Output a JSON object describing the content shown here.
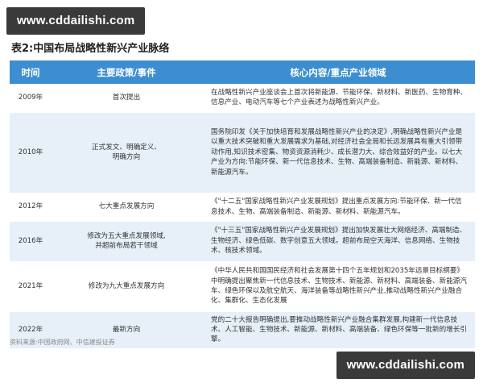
{
  "watermark_text": "www.cddailishi.com",
  "title": "表2:中国布局战略性新兴产业脉络",
  "headers": [
    "时间",
    "主要政策/事件",
    "核心内容/重点产业领域"
  ],
  "rows": [
    {
      "year": "2009年",
      "policy": [
        "首次提出"
      ],
      "content": "在战略性新兴产业座谈会上首次将新能源、节能环保、新材料、新医药、生物育种、信息产业、电动汽车等七个产业表述为战略性新兴产业。"
    },
    {
      "year": "2010年",
      "policy": [
        "正式发文、明确定义、",
        "明确方向"
      ],
      "content": "国务院印发《关于加快培育和发展战略性新兴产业的决定》,明确战略性新兴产业是以重大技术突破和重大发展需求为基础,对经济社会全局和长远发展具有重大引领带动作用,知识技术密集、物资资源消耗少、成长潜力大、综合效益好的产业。以七大产业为方向:节能环保、新一代信息技术、生物、高端装备制造、新能源、新材料、新能源汽车。"
    },
    {
      "year": "2012年",
      "policy": [
        "七大重点发展方向"
      ],
      "content": "《\"十二五\"国家战略性新兴产业发展规划》提出重点发展方向:节能环保、新一代信息技术、生物、高端装备制造、新能源、新材料、新能源汽车。"
    },
    {
      "year": "2016年",
      "policy": [
        "修改为五大重点发展领域,",
        "并超前布局若干领域"
      ],
      "content": "《\"十三五\"国家战略性新兴产业发展规划》提出加快发展壮大网络经济、高端制造、生物经济、绿色低碳、数字创意五大领域。超前布局空天海洋、信息网络、生物技术、核技术领域。"
    },
    {
      "year": "2021年",
      "policy": [
        "修改为九大重点发展方向"
      ],
      "content": "《中华人民共和国国民经济和社会发展第十四个五年规划和2035年远景目标纲要》中明确提出聚焦新一代信息技术、生物技术、新能源、新材料、高端装备、新能源汽车、绿色环保以及航空航天、海洋装备等战略性新兴产业,推动战略性新兴产业融合化、集群化、生态化发展"
    },
    {
      "year": "2022年",
      "policy": [
        "最新方向"
      ],
      "content": "党的二十大报告明确提出,要推动战略性新兴产业融合集群发展,构建新一代信息技术、人工智能、生物技术、新能源、新材料、高端装备、绿色环保等一批新的增长引擎。"
    }
  ],
  "source": "资料来源:中国政府网、中信建投证券"
}
